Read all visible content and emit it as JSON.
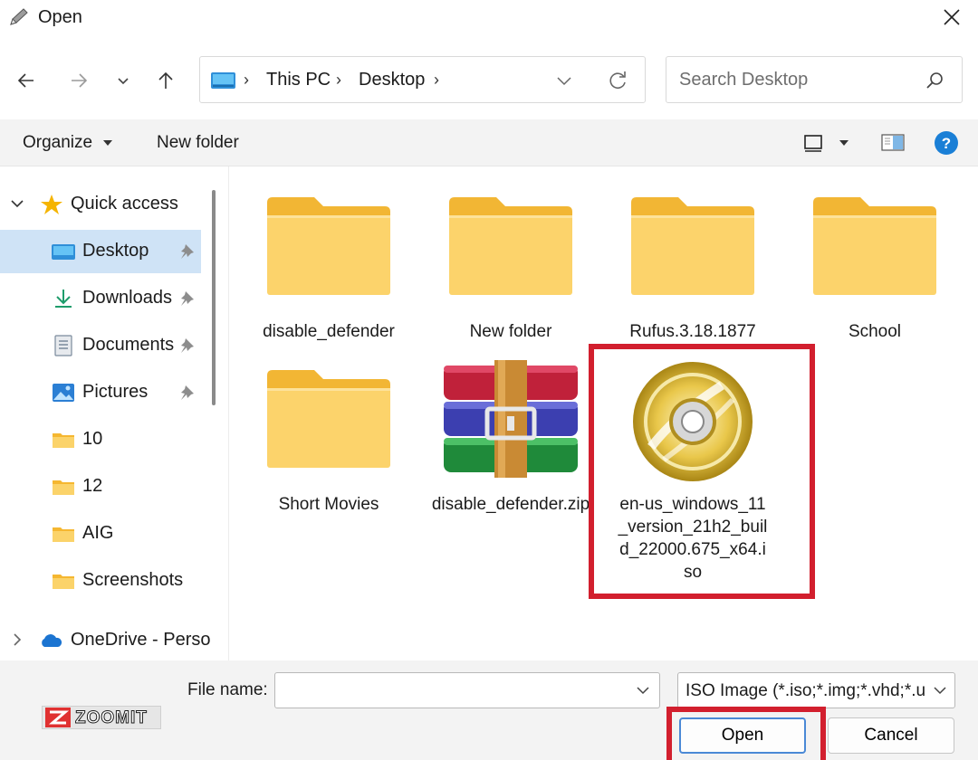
{
  "window": {
    "title": "Open"
  },
  "address": {
    "segments": [
      "This PC",
      "Desktop"
    ]
  },
  "search": {
    "placeholder": "Search Desktop"
  },
  "commands": {
    "organize": "Organize",
    "new_folder": "New folder"
  },
  "sidebar": {
    "items": [
      {
        "label": "Quick access",
        "icon": "star-icon"
      },
      {
        "label": "Desktop",
        "icon": "desktop-icon",
        "pinned": true,
        "selected": true
      },
      {
        "label": "Downloads",
        "icon": "download-icon",
        "pinned": true
      },
      {
        "label": "Documents",
        "icon": "document-icon",
        "pinned": true
      },
      {
        "label": "Pictures",
        "icon": "pictures-icon",
        "pinned": true
      },
      {
        "label": "10",
        "icon": "folder-icon"
      },
      {
        "label": "12",
        "icon": "folder-icon"
      },
      {
        "label": "AIG",
        "icon": "folder-icon"
      },
      {
        "label": "Screenshots",
        "icon": "folder-icon"
      },
      {
        "label": "OneDrive - Perso",
        "icon": "cloud-icon"
      }
    ]
  },
  "files": [
    {
      "name": "disable_defender",
      "type": "folder"
    },
    {
      "name": "New folder",
      "type": "folder"
    },
    {
      "name": "Rufus.3.18.1877",
      "type": "folder"
    },
    {
      "name": "School",
      "type": "folder"
    },
    {
      "name": "Short Movies",
      "type": "folder"
    },
    {
      "name": "disable_defender.zip",
      "type": "zip"
    },
    {
      "name": "en-us_windows_11_version_21h2_build_22000.675_x64.iso",
      "type": "iso",
      "highlighted": true
    }
  ],
  "footer": {
    "file_name_label": "File name:",
    "file_name_value": "",
    "file_type": "ISO Image (*.iso;*.img;*.vhd;*.u",
    "open_label": "Open",
    "cancel_label": "Cancel"
  },
  "watermark": "ZOOMIT",
  "colors": {
    "accent": "#0067c0",
    "highlight": "#d21f2e",
    "folder": "#f8c443",
    "selected": "#cfe3f6"
  }
}
